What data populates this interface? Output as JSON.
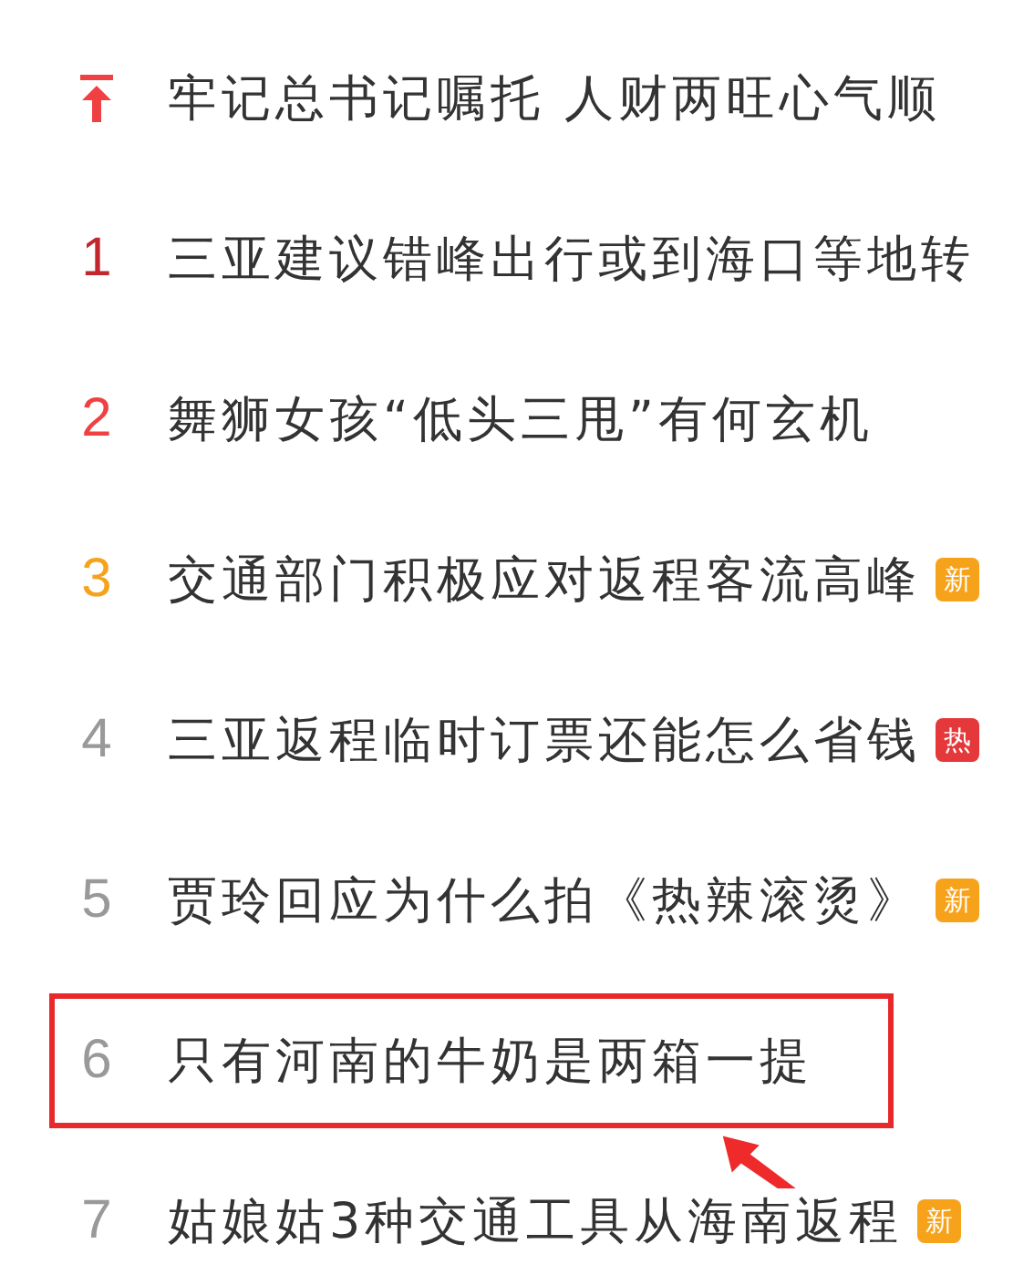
{
  "hot_list": [
    {
      "kind": "pinned",
      "title": "牢记总书记嘱托 人财两旺心气顺",
      "color": "#f04142",
      "highlighted": false
    },
    {
      "kind": "rank",
      "rank": "1",
      "title": "三亚建议错峰出行或到海口等地转",
      "color": "#c1272d",
      "highlighted": false
    },
    {
      "kind": "rank",
      "rank": "2",
      "title": "舞狮女孩“低头三甩”有何玄机",
      "color": "#f04142",
      "highlighted": false
    },
    {
      "kind": "rank",
      "rank": "3",
      "title": "交通部门积极应对返程客流高峰",
      "color": "#f5a31c",
      "highlighted": false,
      "badge": {
        "kind": "new",
        "label": "新"
      }
    },
    {
      "kind": "rank",
      "rank": "4",
      "title": "三亚返程临时订票还能怎么省钱",
      "color": "#999999",
      "highlighted": false,
      "badge": {
        "kind": "hot",
        "label": "热"
      }
    },
    {
      "kind": "rank",
      "rank": "5",
      "title": "贾玲回应为什么拍《热辣滚烫》",
      "color": "#999999",
      "highlighted": false,
      "badge": {
        "kind": "new",
        "label": "新"
      }
    },
    {
      "kind": "rank",
      "rank": "6",
      "title": "只有河南的牛奶是两箱一提",
      "color": "#999999",
      "highlighted": true
    },
    {
      "kind": "rank",
      "rank": "7",
      "title": "姑娘姑3种交通工具从海南返程",
      "color": "#999999",
      "highlighted": false,
      "badge": {
        "kind": "new",
        "label": "新"
      }
    }
  ]
}
